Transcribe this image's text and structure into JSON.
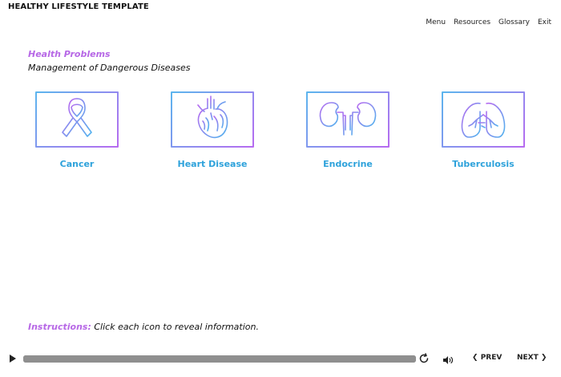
{
  "app": {
    "title": "HEALTHY LIFESTYLE TEMPLATE"
  },
  "nav": {
    "items": [
      "Menu",
      "Resources",
      "Glossary",
      "Exit"
    ]
  },
  "page": {
    "title": "Health Problems",
    "subtitle": "Management of Dangerous Diseases"
  },
  "tiles": [
    {
      "label": "Cancer",
      "icon": "awareness-ribbon-icon"
    },
    {
      "label": "Heart Disease",
      "icon": "heart-organ-icon"
    },
    {
      "label": "Endocrine",
      "icon": "kidneys-icon"
    },
    {
      "label": "Tuberculosis",
      "icon": "lungs-icon"
    }
  ],
  "instructions": {
    "label": "Instructions:",
    "text": "Click each icon to reveal information."
  },
  "player": {
    "progress": 1.0,
    "prev_label": "PREV",
    "next_label": "NEXT"
  },
  "colors": {
    "accent_purple": "#b768e6",
    "accent_blue": "#2ea2db",
    "progress": "#8f8f8f"
  }
}
